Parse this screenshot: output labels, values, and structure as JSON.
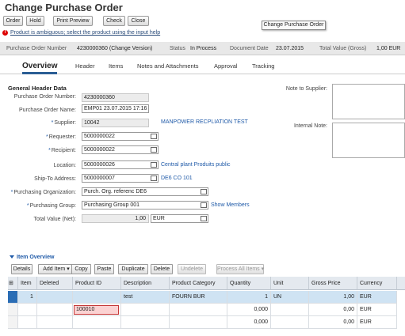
{
  "title": "Change Purchase Order",
  "toolbar": {
    "order": "Order",
    "hold": "Hold",
    "print_preview": "Print Preview",
    "check": "Check",
    "close": "Close"
  },
  "tooltip": "Change Purchase Order",
  "message": {
    "prefix": "Product is ambiguous; select the product using the input help"
  },
  "infobar": {
    "po_number_label": "Purchase Order Number",
    "po_number_value": "4230000360 (Change Version)",
    "status_label": "Status",
    "status_value": "In Process",
    "doc_date_label": "Document Date",
    "doc_date_value": "23.07.2015",
    "total_label": "Total Value (Gross)",
    "total_value": "1,00 EUR"
  },
  "tabs": [
    "Overview",
    "Header",
    "Items",
    "Notes and Attachments",
    "Approval",
    "Tracking"
  ],
  "header_section": "General Header Data",
  "fields": {
    "po_number": {
      "label": "Purchase Order Number:",
      "value": "4230000360"
    },
    "po_name": {
      "label": "Purchase Order Name:",
      "value": "EMP01 23.07.2015 17:16"
    },
    "supplier": {
      "label": "Supplier:",
      "value": "10042",
      "link": "MANPOWER RECPLIATION TEST"
    },
    "requester": {
      "label": "Requester:",
      "value": "5000000022"
    },
    "recipient": {
      "label": "Recipient:",
      "value": "5000000022"
    },
    "location": {
      "label": "Location:",
      "value": "5000000026",
      "link": "Central plant Produits public"
    },
    "ship_to": {
      "label": "Ship-To Address:",
      "value": "5000000007",
      "link": "DE6 CO 101"
    },
    "purch_org": {
      "label": "Purchasing Organization:",
      "value": "Purch. Org. referenc DE6"
    },
    "purch_group": {
      "label": "Purchasing Group:",
      "value": "Purchasing Group 001",
      "link": "Show Members"
    },
    "total_net": {
      "label": "Total Value (Net):",
      "value": "1,00",
      "currency": "EUR"
    }
  },
  "notes": {
    "supplier_label": "Note to Supplier:",
    "internal_label": "Internal Note:"
  },
  "item_overview": {
    "title": "Item Overview",
    "buttons": {
      "details": "Details",
      "add_item": "Add Item",
      "copy": "Copy",
      "paste": "Paste",
      "duplicate": "Duplicate",
      "delete": "Delete",
      "undelete": "Undelete",
      "process_all": "Process All Items"
    },
    "columns": [
      "Item",
      "Deleted",
      "Product ID",
      "Description",
      "Product Category",
      "Quantity",
      "Unit",
      "Gross Price",
      "Currency"
    ],
    "rows": [
      {
        "item": "1",
        "deleted": "",
        "product_id": "",
        "description": "test",
        "category": "FOURN BUR",
        "quantity": "1",
        "unit": "UN",
        "price": "1,00",
        "currency": "EUR"
      },
      {
        "item": "",
        "deleted": "",
        "product_id": "100010",
        "description": "",
        "category": "",
        "quantity": "0,000",
        "unit": "",
        "price": "0,00",
        "currency": "EUR"
      },
      {
        "item": "",
        "deleted": "",
        "product_id": "",
        "description": "",
        "category": "",
        "quantity": "0,000",
        "unit": "",
        "price": "0,00",
        "currency": "EUR"
      }
    ]
  }
}
